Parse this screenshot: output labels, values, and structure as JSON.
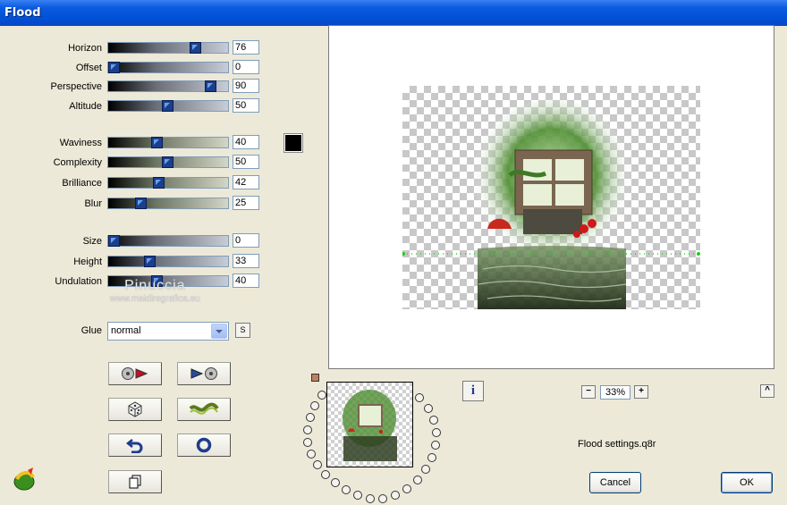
{
  "window": {
    "title": "Flood"
  },
  "params": [
    {
      "label": "Horizon",
      "value": "76",
      "pct": 0.76,
      "track": "gray"
    },
    {
      "label": "Offset",
      "value": "0",
      "pct": 0.0,
      "track": "gray"
    },
    {
      "label": "Perspective",
      "value": "90",
      "pct": 0.9,
      "track": "gray"
    },
    {
      "label": "Altitude",
      "value": "50",
      "pct": 0.5,
      "track": "gray"
    },
    {
      "label": "Waviness",
      "value": "40",
      "pct": 0.4,
      "track": "olive"
    },
    {
      "label": "Complexity",
      "value": "50",
      "pct": 0.5,
      "track": "olive"
    },
    {
      "label": "Brilliance",
      "value": "42",
      "pct": 0.42,
      "track": "olive"
    },
    {
      "label": "Blur",
      "value": "25",
      "pct": 0.25,
      "track": "olive"
    },
    {
      "label": "Size",
      "value": "0",
      "pct": 0.0,
      "track": "gray"
    },
    {
      "label": "Height",
      "value": "33",
      "pct": 0.33,
      "track": "gray"
    },
    {
      "label": "Undulation",
      "value": "40",
      "pct": 0.4,
      "track": "gray"
    }
  ],
  "color": "#000000",
  "glue": {
    "label": "Glue",
    "value": "normal",
    "s_label": "S"
  },
  "watermark": {
    "line1": "Pinuccia",
    "line2": "www.maidiregrafica.eu"
  },
  "zoom": {
    "value": "33%",
    "minus": "−",
    "plus": "+"
  },
  "scroll_up_label": "^",
  "info_label": "i",
  "settings_file": "Flood settings.q8r",
  "buttons": {
    "cancel": "Cancel",
    "ok": "OK"
  }
}
